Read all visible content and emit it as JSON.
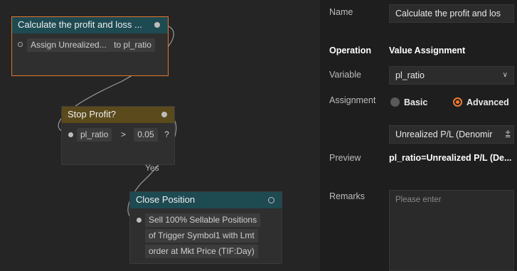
{
  "nodes": {
    "calc": {
      "title": "Calculate the profit and loss ...",
      "row_var": "Assign Unrealized...",
      "row_to": "to pl_ratio"
    },
    "stop": {
      "title": "Stop Profit?",
      "var": "pl_ratio",
      "op": ">",
      "value": "0.05",
      "q": "?"
    },
    "yes_label": "Yes",
    "close": {
      "title": "Close Position",
      "lines": [
        "Sell 100% Sellable Positions",
        "of Trigger Symbol1 with Lmt",
        "order at Mkt Price  (TIF:Day)"
      ]
    }
  },
  "panel": {
    "name_label": "Name",
    "name_value": "Calculate the profit and los",
    "operation_label": "Operation",
    "operation_value": "Value Assignment",
    "variable_label": "Variable",
    "variable_value": "pl_ratio",
    "assignment_label": "Assignment",
    "basic_label": "Basic",
    "advanced_label": "Advanced",
    "assignment_selected": "Advanced",
    "expression_value": "Unrealized P/L (Denomir",
    "preview_label": "Preview",
    "preview_value": "pl_ratio=Unrealized P/L (De...",
    "remarks_label": "Remarks",
    "remarks_placeholder": "Please enter"
  },
  "colors": {
    "accent": "#e0772a",
    "header_teal": "#1e4a52",
    "header_olive": "#5a4a1c",
    "panel_bg": "#1e1e1e",
    "canvas_bg": "#252525"
  },
  "icons": {
    "dropdown": "chevron-down-icon",
    "expression_edit": "formula-icon"
  }
}
